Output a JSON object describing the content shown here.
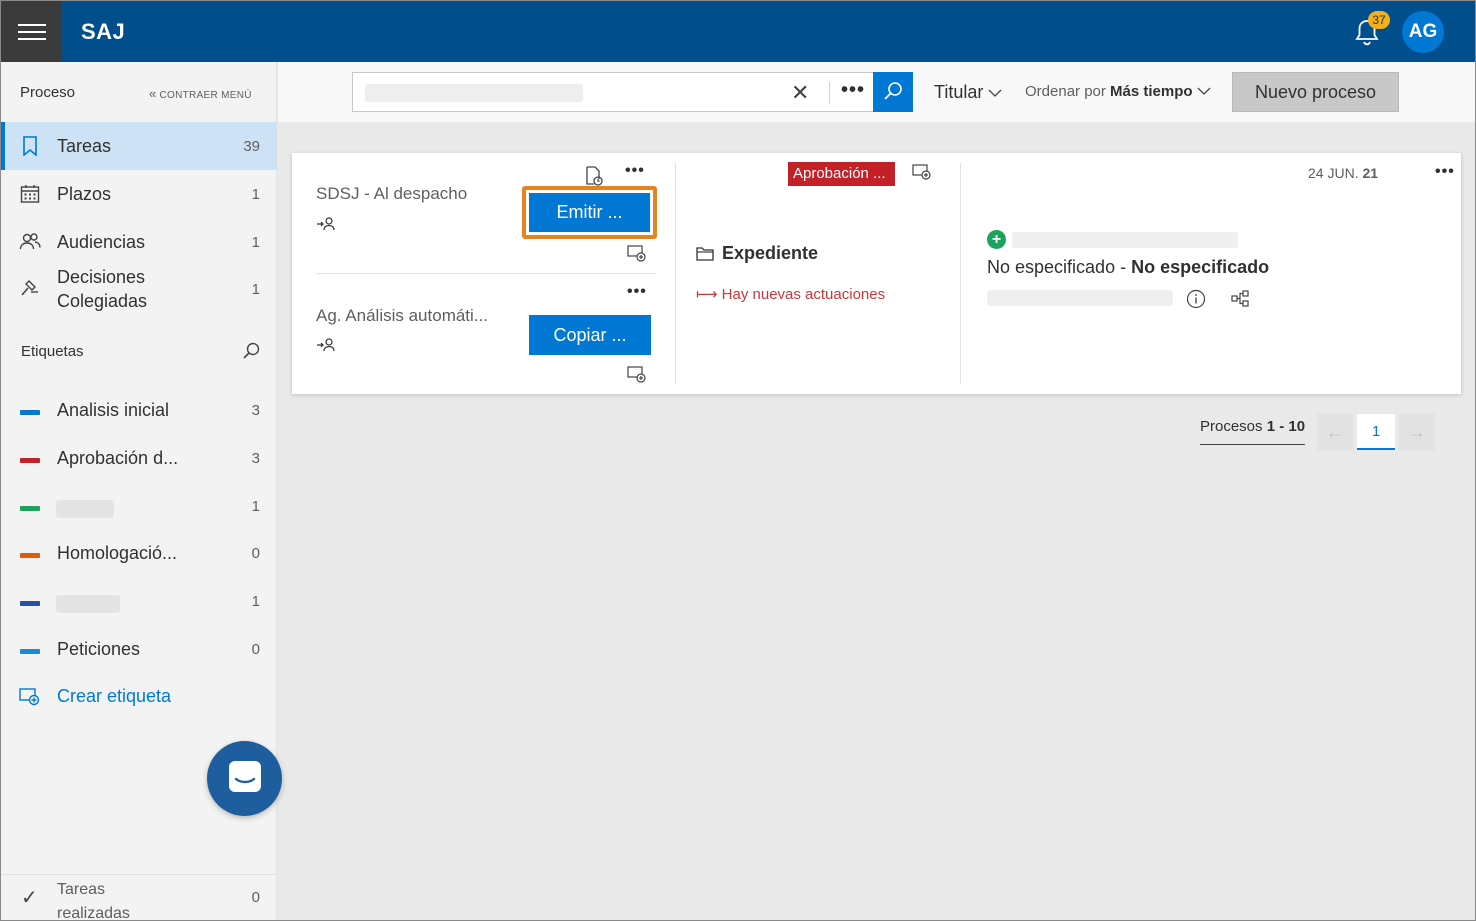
{
  "app": {
    "title": "SAJ"
  },
  "header": {
    "notifications_count": "37",
    "avatar_initials": "AG"
  },
  "sidebar": {
    "title": "Proceso",
    "collapse_label": "CONTRAER MENÚ",
    "items": [
      {
        "label": "Tareas",
        "count": "39",
        "icon": "bookmark-icon",
        "active": true
      },
      {
        "label": "Plazos",
        "count": "1",
        "icon": "calendar-icon"
      },
      {
        "label": "Audiencias",
        "count": "1",
        "icon": "people-icon"
      },
      {
        "label": "Decisiones Colegiadas",
        "count": "1",
        "icon": "gavel-icon"
      }
    ],
    "tags_title": "Etiquetas",
    "tags": [
      {
        "label": "Analisis inicial",
        "count": "3",
        "color": "#0078d4"
      },
      {
        "label": "Aprobación d...",
        "count": "3",
        "color": "#c12127"
      },
      {
        "label": "",
        "count": "1",
        "color": "#1aa35a"
      },
      {
        "label": "Homologació...",
        "count": "0",
        "color": "#e05a0c"
      },
      {
        "label": "",
        "count": "1",
        "color": "#2b4fa3"
      },
      {
        "label": "Peticiones",
        "count": "0",
        "color": "#1a8ad4"
      }
    ],
    "create_tag_label": "Crear etiqueta",
    "done_label": "Tareas realizadas",
    "done_count": "0"
  },
  "toolbar": {
    "filter_label": "Titular",
    "sort_prefix": "Ordenar por",
    "sort_value": "Más tiempo",
    "new_button": "Nuevo proceso"
  },
  "card": {
    "tasks": [
      {
        "title": "SDSJ - Al despacho",
        "action": "Emitir ..."
      },
      {
        "title": "Ag. Análisis automáti...",
        "action": "Copiar ..."
      }
    ],
    "tag_badge": "Aprobación ...",
    "expediente_label": "Expediente",
    "news_label": "Hay nuevas actuaciones",
    "date_day": "24 JUN.",
    "date_year": "21",
    "spec_left": "No especificado",
    "spec_sep": " - ",
    "spec_right": "No especificado"
  },
  "pagination": {
    "label_prefix": "Procesos",
    "range": "1 - 10",
    "current_page": "1"
  },
  "colors": {
    "header_bg": "#004e8c",
    "accent": "#0078d4",
    "highlight": "#e8821e",
    "badge_red": "#c12127"
  }
}
